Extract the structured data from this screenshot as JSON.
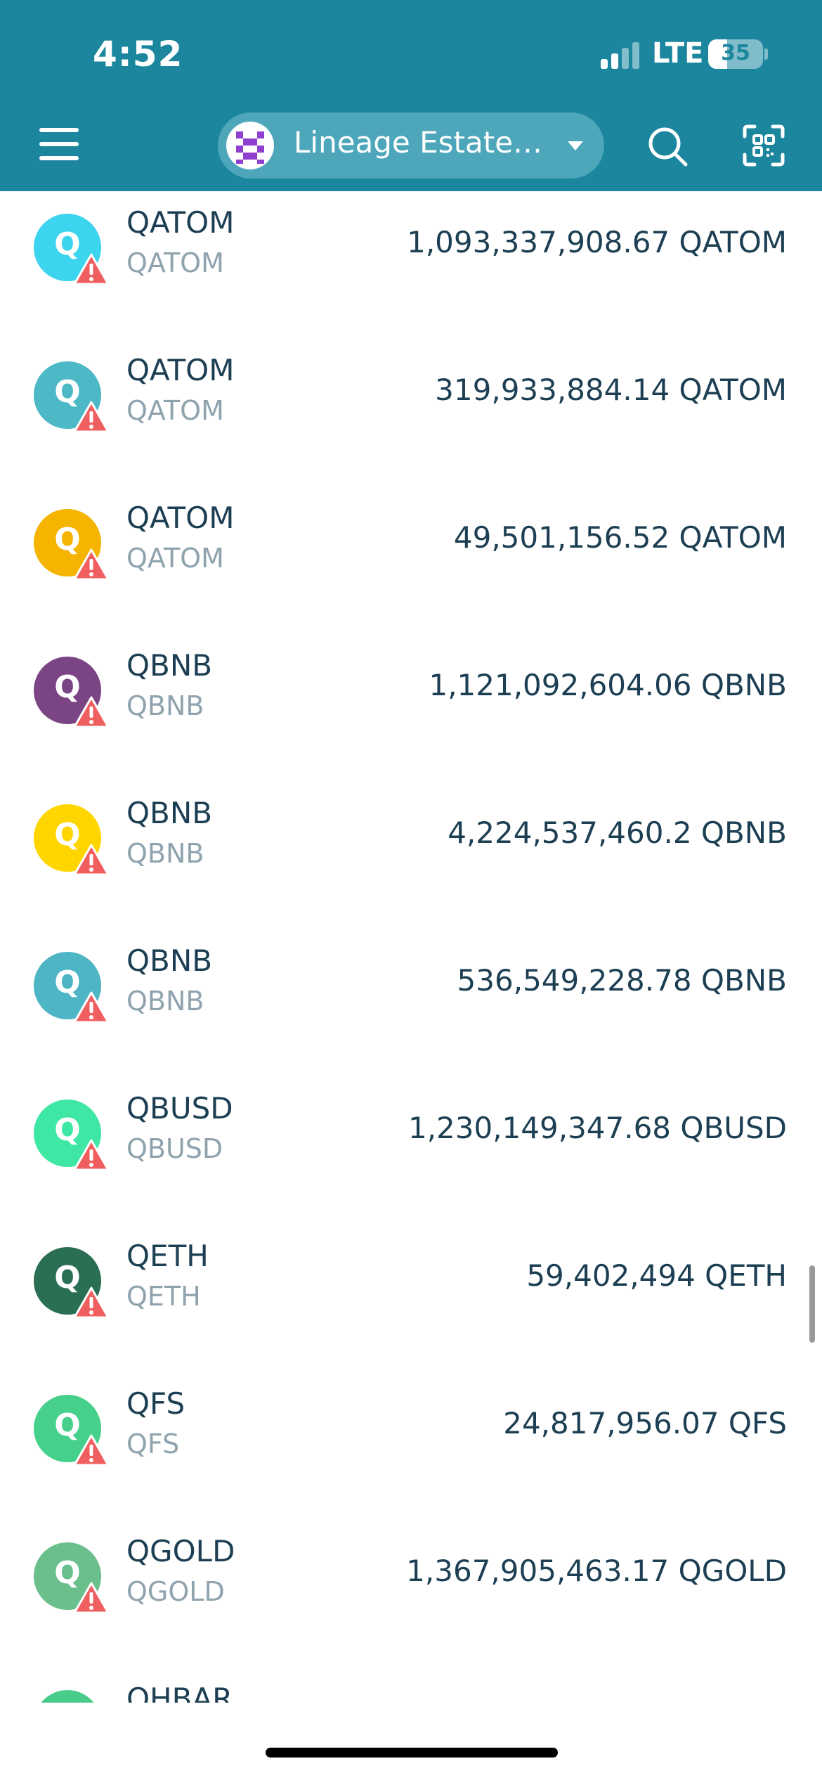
{
  "status_bar": {
    "time": "4:52",
    "network": "LTE",
    "battery_percent": 35
  },
  "header": {
    "wallet_name": "Lineage Estate…",
    "icons": {
      "menu": "hamburger-menu-icon",
      "search": "search-icon",
      "scan": "scan-qr-icon",
      "dropdown": "chevron-down-icon"
    }
  },
  "tokens": [
    {
      "name": "QATOM",
      "symbol": "QATOM",
      "amount": "1,093,337,908.67 QATOM",
      "color": "#3CD4EE",
      "icon_letter": "Q"
    },
    {
      "name": "QATOM",
      "symbol": "QATOM",
      "amount": "319,933,884.14 QATOM",
      "color": "#4DB8C6",
      "icon_letter": "Q"
    },
    {
      "name": "QATOM",
      "symbol": "QATOM",
      "amount": "49,501,156.52 QATOM",
      "color": "#F4B400",
      "icon_letter": "Q"
    },
    {
      "name": "QBNB",
      "symbol": "QBNB",
      "amount": "1,121,092,604.06 QBNB",
      "color": "#7B4585",
      "icon_letter": "Q"
    },
    {
      "name": "QBNB",
      "symbol": "QBNB",
      "amount": "4,224,537,460.2 QBNB",
      "color": "#FFD500",
      "icon_letter": "Q"
    },
    {
      "name": "QBNB",
      "symbol": "QBNB",
      "amount": "536,549,228.78 QBNB",
      "color": "#4DB5C4",
      "icon_letter": "Q"
    },
    {
      "name": "QBUSD",
      "symbol": "QBUSD",
      "amount": "1,230,149,347.68 QBUSD",
      "color": "#3FE7A5",
      "icon_letter": "Q"
    },
    {
      "name": "QETH",
      "symbol": "QETH",
      "amount": "59,402,494 QETH",
      "color": "#2A6E54",
      "icon_letter": "Q"
    },
    {
      "name": "QFS",
      "symbol": "QFS",
      "amount": "24,817,956.07 QFS",
      "color": "#47D08C",
      "icon_letter": "Q"
    },
    {
      "name": "QGOLD",
      "symbol": "QGOLD",
      "amount": "1,367,905,463.17 QGOLD",
      "color": "#6BBF8C",
      "icon_letter": "Q"
    },
    {
      "name": "QHBAR",
      "symbol": "",
      "amount": "",
      "color": "#49CC89",
      "icon_letter": ""
    }
  ],
  "warning_icon": {
    "name": "warning-icon",
    "color": "#F05F5F"
  },
  "theme": {
    "header_bg": "#1B869E",
    "pill_bg": "#4DA6BA",
    "text_primary": "#1D3F53",
    "text_secondary": "#8FA3AE"
  }
}
